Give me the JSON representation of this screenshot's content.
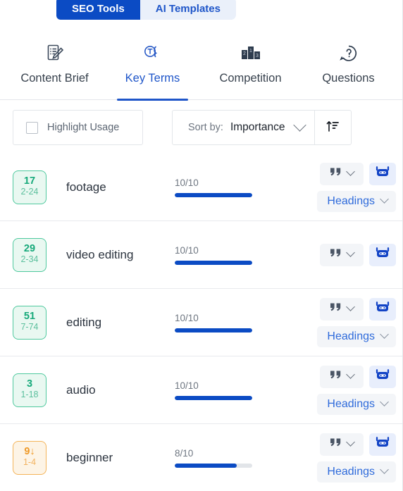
{
  "segmented": {
    "items": [
      {
        "label": "SEO Tools",
        "active": true
      },
      {
        "label": "AI Templates",
        "active": false
      }
    ]
  },
  "nav_tabs": [
    {
      "label": "Content Brief",
      "icon": "document-pencil-icon",
      "active": false
    },
    {
      "label": "Key Terms",
      "icon": "text-bubble-icon",
      "active": true
    },
    {
      "label": "Competition",
      "icon": "podium-icon",
      "active": false
    },
    {
      "label": "Questions",
      "icon": "question-bubble-icon",
      "active": false
    }
  ],
  "controls": {
    "highlight_usage_label": "Highlight Usage",
    "highlight_usage_checked": false,
    "sort_by_label": "Sort by:",
    "sort_by_value": "Importance",
    "sort_direction_icon": "sort-ascending-icon"
  },
  "actions": {
    "quote_icon": "quote-icon",
    "ai_icon": "robot-icon",
    "headings_label": "Headings"
  },
  "colors": {
    "accent_blue": "#0b4bc4",
    "link_blue": "#2f6bdb",
    "badge_green_border": "#4fc99e",
    "badge_green_bg": "#e9f8f1",
    "badge_green_text": "#16a97a",
    "badge_orange_border": "#f4b459",
    "badge_orange_bg": "#fdf4e6",
    "badge_orange_text": "#ef9a28",
    "bar_track": "#e2e5e9"
  },
  "terms": [
    {
      "count": "17",
      "count_trend": "",
      "range": "2-24",
      "badge_color": "green",
      "term": "footage",
      "score_text": "10/10",
      "score_value": 10,
      "score_max": 10,
      "has_headings": true
    },
    {
      "count": "29",
      "count_trend": "",
      "range": "2-34",
      "badge_color": "green",
      "term": "video editing",
      "score_text": "10/10",
      "score_value": 10,
      "score_max": 10,
      "has_headings": false
    },
    {
      "count": "51",
      "count_trend": "",
      "range": "7-74",
      "badge_color": "green",
      "term": "editing",
      "score_text": "10/10",
      "score_value": 10,
      "score_max": 10,
      "has_headings": true
    },
    {
      "count": "3",
      "count_trend": "",
      "range": "1-18",
      "badge_color": "green",
      "term": "audio",
      "score_text": "10/10",
      "score_value": 10,
      "score_max": 10,
      "has_headings": true
    },
    {
      "count": "9",
      "count_trend": "↓",
      "range": "1-4",
      "badge_color": "orange",
      "term": "beginner",
      "score_text": "8/10",
      "score_value": 8,
      "score_max": 10,
      "has_headings": true
    }
  ]
}
